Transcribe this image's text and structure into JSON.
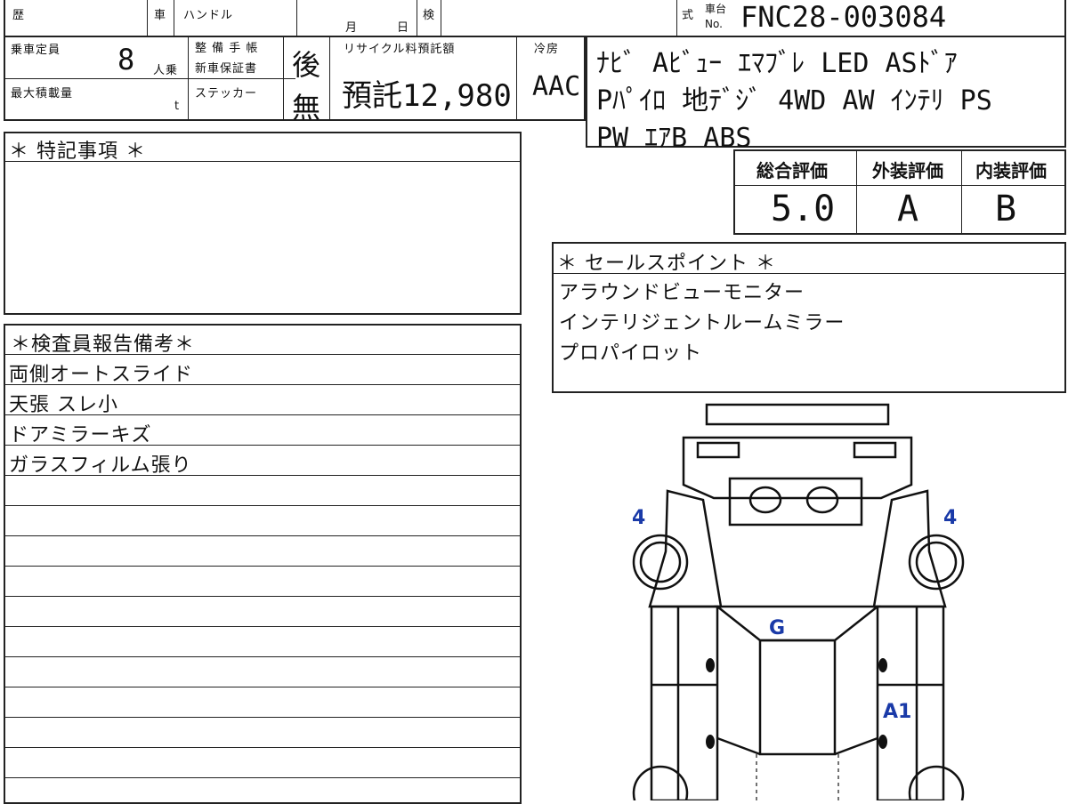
{
  "header": {
    "history_label": "歴",
    "car_label": "車",
    "handle_label": "ハンドル",
    "month_label": "月",
    "day_label": "日",
    "inspection_label": "検",
    "model_label": "式",
    "chassis_label": "車台",
    "chassis_no_label": "No.",
    "chassis_number": "FNC28-003084"
  },
  "specs": {
    "capacity_label": "乗車定員",
    "capacity_value": "8",
    "capacity_unit": "人乗",
    "max_load_label": "最大積載量",
    "max_load_unit": "t",
    "maintenance_label": "整 備 手 帳",
    "warranty_label": "新車保証書",
    "maintenance_value": "後",
    "sticker_label": "ステッカー",
    "sticker_value": "無",
    "recycle_label": "リサイクル料預託額",
    "recycle_value": "預託12,980",
    "ac_label": "冷房",
    "ac_value": "AAC"
  },
  "equipment": {
    "line1": "ﾅﾋﾞ Aﾋﾞｭｰ ｴﾏﾌﾞﾚ LED ASﾄﾞｱ",
    "line2": "Pﾊﾟｲﾛ 地ﾃﾞｼﾞ 4WD AW ｲﾝﾃﾘ PS",
    "line3": "PW ｴｱB ABS"
  },
  "grades": {
    "overall_label": "総合評価",
    "exterior_label": "外装評価",
    "interior_label": "内装評価",
    "overall": "5.0",
    "exterior": "A",
    "interior": "B"
  },
  "special_notes": {
    "title": "＊ 特記事項 ＊"
  },
  "sales_points": {
    "title": "＊ セールスポイント ＊",
    "items": [
      "アラウンドビューモニター",
      "インテリジェントルームミラー",
      "プロパイロット"
    ]
  },
  "inspector_notes": {
    "title": "＊検査員報告備考＊",
    "items": [
      "両側オートスライド",
      "天張 スレ小",
      "ドアミラーキズ",
      "ガラスフィルム張り"
    ]
  },
  "diagram": {
    "marks": {
      "left_tire": "4",
      "right_tire": "4",
      "roof": "G",
      "right_door": "A1"
    },
    "mark_color": "#1a3aa8"
  }
}
